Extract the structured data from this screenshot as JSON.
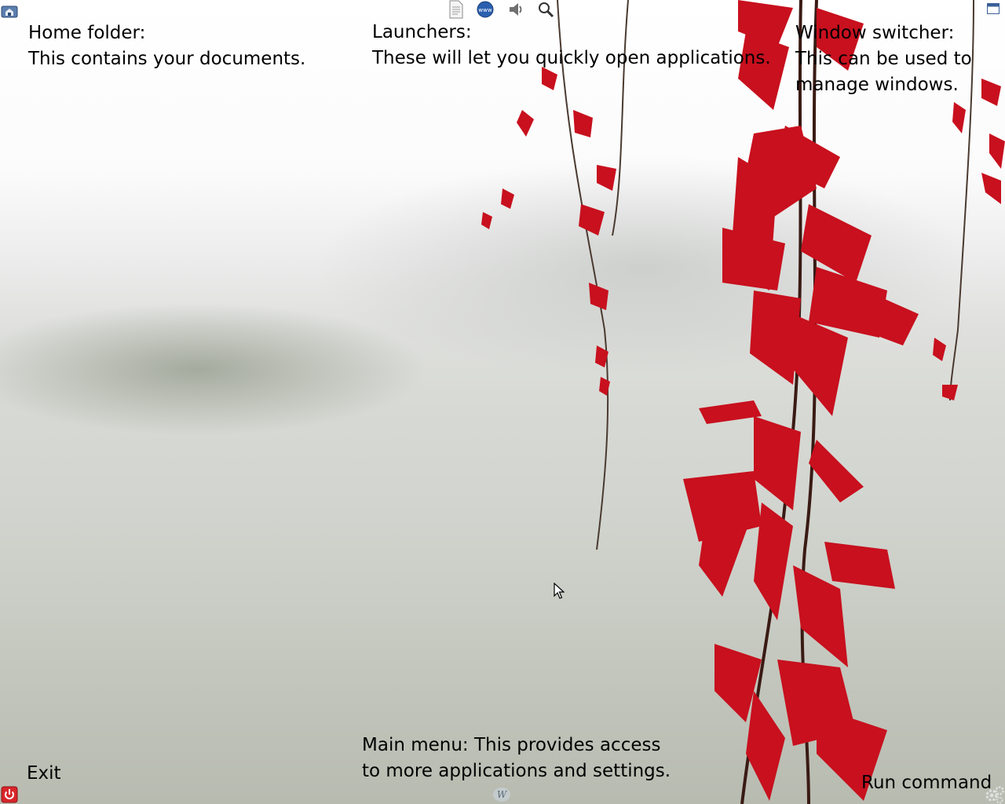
{
  "hints": {
    "home_folder": {
      "title": "Home folder:",
      "body": "This contains your documents."
    },
    "launchers": {
      "title": "Launchers:",
      "body": "These will let you quickly open applications."
    },
    "window_switcher": {
      "line1": "Window switcher:",
      "line2": "This can be used to",
      "line3": "manage windows."
    },
    "main_menu": {
      "line1": "Main menu: This provides access",
      "line2": "to more applications and settings."
    },
    "exit": {
      "label": "Exit"
    },
    "run_command": {
      "label": "Run command"
    }
  },
  "panel_icons": {
    "top_left": "home-folder-icon",
    "launchers": [
      "text-editor-icon",
      "web-browser-icon",
      "volume-icon",
      "search-icon"
    ],
    "top_right": "window-switcher-icon",
    "bottom_left": "power-icon",
    "bottom_center": "main-menu-icon",
    "bottom_right": "settings-gears-icon"
  },
  "colors": {
    "leaf_red": "#c8101e",
    "stem": "#3a1a14",
    "power_red": "#d8262a"
  }
}
